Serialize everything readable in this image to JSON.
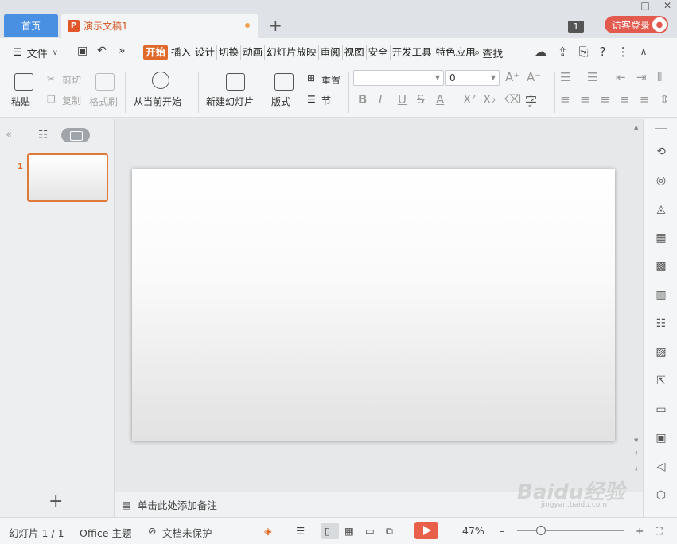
{
  "titlebar": {
    "home_tab": "首页",
    "doc_tab": "演示文稿1",
    "doc_icon": "P",
    "add_tab": "+",
    "window_badge": "1",
    "login_label": "访客登录",
    "win_minimize": "–",
    "win_maximize": "□",
    "win_close": "✕"
  },
  "menubar": {
    "file": "文件",
    "file_chevron": "∨",
    "more": "»",
    "tabs": [
      "开始",
      "插入",
      "设计",
      "切换",
      "动画",
      "幻灯片放映",
      "审阅",
      "视图",
      "安全",
      "开发工具",
      "特色应用"
    ],
    "search": "查找",
    "help": "?",
    "options": "⋮",
    "collapse": "∧"
  },
  "ribbon": {
    "paste": "粘贴",
    "cut": "剪切",
    "copy": "复制",
    "format_painter": "格式刷",
    "from_current": "从当前开始",
    "new_slide": "新建幻灯片",
    "layout": "版式",
    "reset": "重置",
    "section": "节",
    "font_name": "",
    "font_size": "0"
  },
  "leftpanel": {
    "collapse": "«",
    "slide_number": "1",
    "add_slide": "+"
  },
  "notes": {
    "placeholder": "单击此处添加备注"
  },
  "statusbar": {
    "slide_info": "幻灯片 1 / 1",
    "theme": "Office 主题",
    "protection": "文档未保护",
    "zoom": "47%",
    "zoom_out": "–",
    "zoom_in": "+"
  },
  "watermark": {
    "text": "Baidu经验",
    "url": "jingyan.baidu.com"
  },
  "colors": {
    "accent": "#e06a2a",
    "home_tab": "#4a90e2",
    "login_button": "#e35b4f",
    "play_button": "#e8604a"
  }
}
